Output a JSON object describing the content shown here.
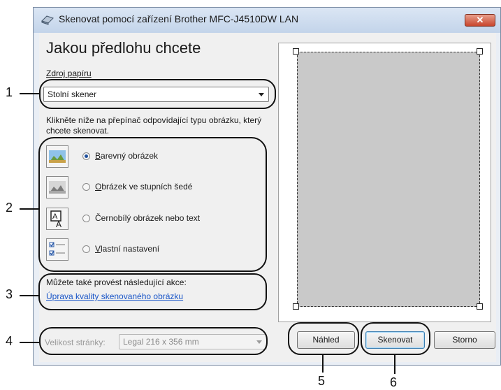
{
  "window": {
    "title": "Skenovat pomocí zařízení Brother MFC-J4510DW LAN",
    "close_label": "✕"
  },
  "heading": "Jakou předlohu chcete",
  "paper_source": {
    "label": "Zdroj papíru",
    "value": "Stolní skener"
  },
  "instruction": "Klikněte níže na přepínač odpovídající typu obrázku, který chcete skenovat.",
  "image_types": [
    {
      "label": "Barevný obrázek",
      "selected": true,
      "icon": "color-photo-icon"
    },
    {
      "label": "Obrázek ve stupních šedé",
      "selected": false,
      "icon": "grayscale-photo-icon"
    },
    {
      "label": "Černobílý obrázek nebo text",
      "selected": false,
      "icon": "bw-text-icon"
    },
    {
      "label": "Vlastní nastavení",
      "selected": false,
      "icon": "custom-settings-icon"
    }
  ],
  "actions": {
    "label": "Můžete také provést následující akce:",
    "link": "Úprava kvality skenovaného obrázku"
  },
  "page_size": {
    "label": "Velikost stránky:",
    "value": "Legal 216 x 356 mm"
  },
  "buttons": {
    "preview": "Náhled",
    "scan": "Skenovat",
    "cancel": "Storno"
  },
  "callouts": [
    "1",
    "2",
    "3",
    "4",
    "5",
    "6"
  ]
}
